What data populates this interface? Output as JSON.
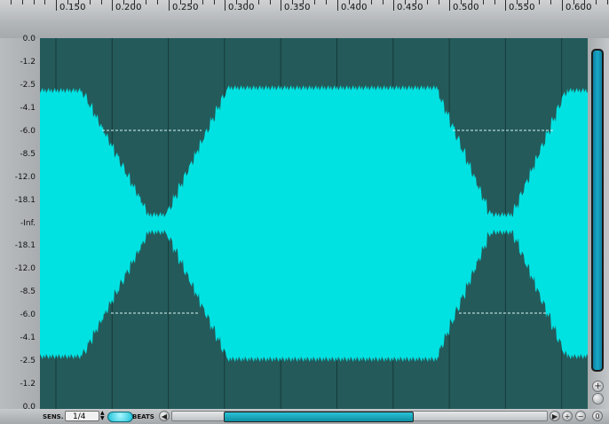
{
  "ruler": {
    "time_labels": [
      "0.150",
      "0.200",
      "0.250",
      "0.300",
      "0.350",
      "0.400",
      "0.450",
      "0.500",
      "0.550",
      "0.600"
    ]
  },
  "db_scale": {
    "labels": [
      "0.0",
      "-1.2",
      "-2.5",
      "-4.1",
      "-6.0",
      "-8.5",
      "-12.0",
      "-18.1",
      "-Inf.",
      "-18.1",
      "-12.0",
      "-8.5",
      "-6.0",
      "-4.1",
      "-2.5",
      "-1.2",
      "0.0"
    ]
  },
  "bottom_bar": {
    "sens_label": "SENS.",
    "sens_value": "1/4",
    "beats_label": "BEATS"
  },
  "scroll_buttons": {
    "left": "◀",
    "right": "▶",
    "zoom_in": "+",
    "zoom_out": "−",
    "reset": "0"
  },
  "colors": {
    "waveform": "#00e2e2",
    "background": "#245a5a",
    "accent": "#19a9c9"
  }
}
